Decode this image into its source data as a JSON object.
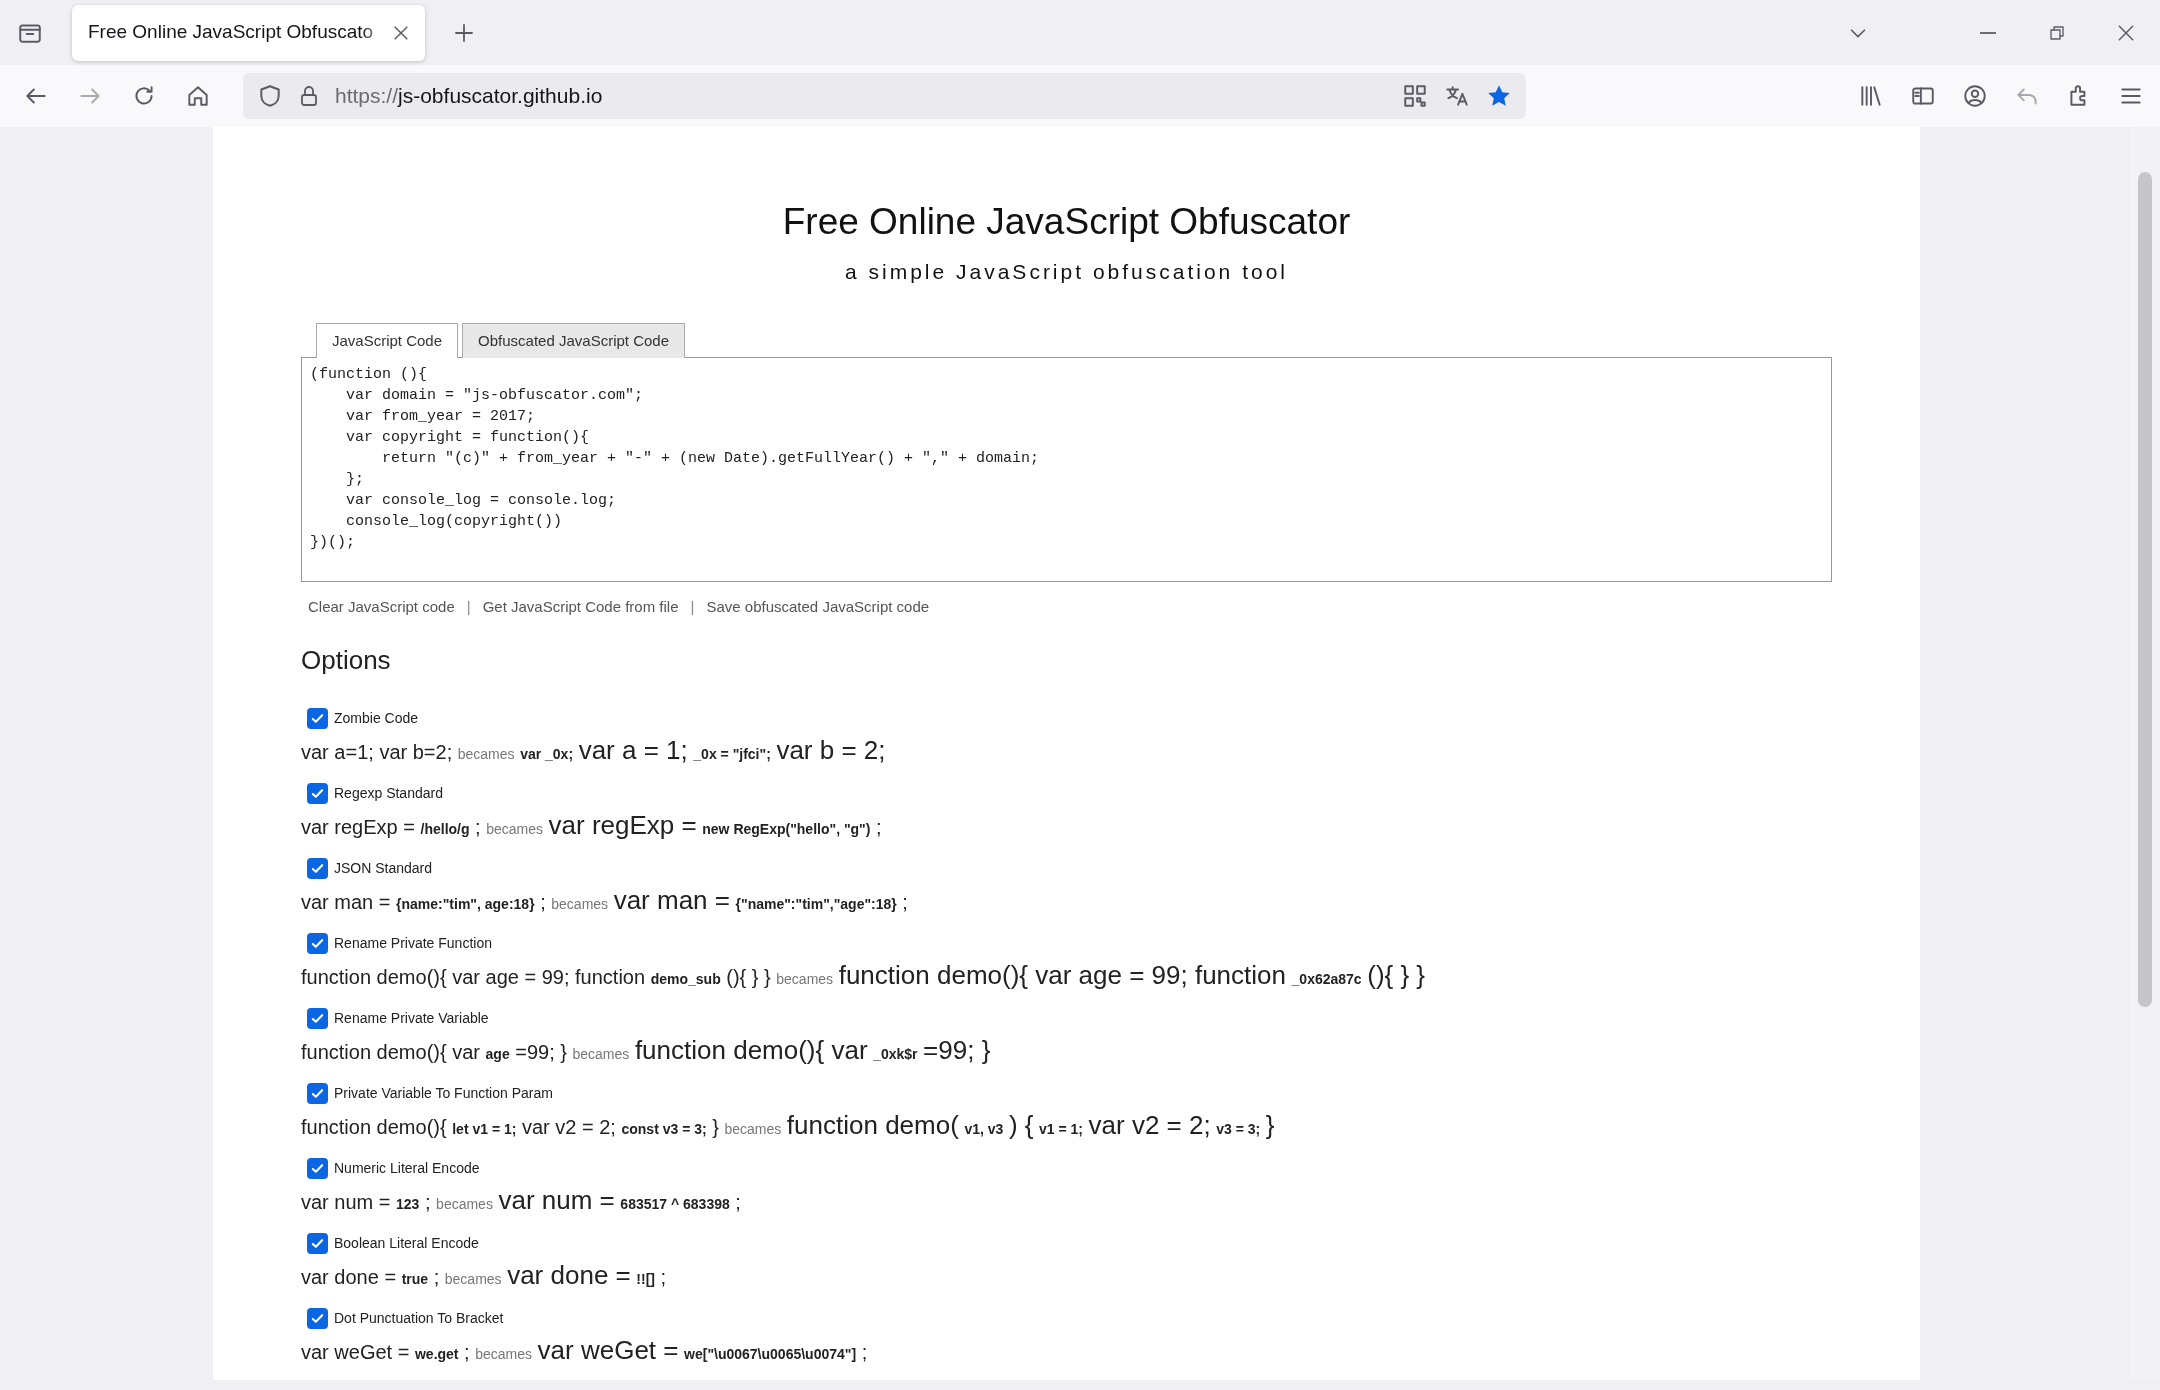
{
  "browser": {
    "tab_title": "Free Online JavaScript Obfuscato",
    "url_scheme": "https://",
    "url_host": "js-obfuscator.github.io",
    "bookmarked": true
  },
  "page": {
    "title": "Free Online JavaScript Obfuscator",
    "subtitle": "a simple JavaScript obfuscation tool",
    "tabs": [
      {
        "label": "JavaScript Code",
        "selected": true
      },
      {
        "label": "Obfuscated JavaScript Code",
        "selected": false
      }
    ],
    "code_lines": [
      "(function (){",
      "    var domain = \"js-obfuscator.com\";",
      "    var from_year = 2017;",
      "    var copyright = function(){",
      "        return \"(c)\" + from_year + \"-\" + (new Date).getFullYear() + \",\" + domain;",
      "    };",
      "    var console_log = console.log;",
      "    console_log(copyright())",
      "})();"
    ],
    "links": [
      {
        "kind": "link",
        "text": "Clear JavaScript code"
      },
      {
        "kind": "separator",
        "text": "|"
      },
      {
        "kind": "link",
        "text": "Get JavaScript Code from file"
      },
      {
        "kind": "separator",
        "text": "|"
      },
      {
        "kind": "link",
        "text": "Save obfuscated JavaScript code"
      }
    ],
    "options_heading": "Options",
    "options": [
      {
        "label": "Zombie Code",
        "checked": true,
        "example": [
          {
            "kind": "src",
            "text": "var a=1; var b=2;"
          },
          {
            "kind": "note",
            "text": "becames"
          },
          {
            "kind": "bold",
            "text": "var _0x;"
          },
          {
            "kind": "out",
            "text": "var a = 1;"
          },
          {
            "kind": "bold",
            "text": "_0x = \"jfci\";"
          },
          {
            "kind": "out",
            "text": "var b = 2;"
          }
        ]
      },
      {
        "label": "Regexp Standard",
        "checked": true,
        "example": [
          {
            "kind": "src",
            "text": "var regExp ="
          },
          {
            "kind": "bold",
            "text": "/hello/g"
          },
          {
            "kind": "src",
            "text": ";"
          },
          {
            "kind": "note",
            "text": "becames"
          },
          {
            "kind": "out",
            "text": "var regExp ="
          },
          {
            "kind": "bold",
            "text": "new RegExp(\"hello\", \"g\")"
          },
          {
            "kind": "src",
            "text": ";"
          }
        ]
      },
      {
        "label": "JSON Standard",
        "checked": true,
        "example": [
          {
            "kind": "src",
            "text": "var man ="
          },
          {
            "kind": "bold",
            "text": "{name:\"tim\", age:18}"
          },
          {
            "kind": "src",
            "text": ";"
          },
          {
            "kind": "note",
            "text": "becames"
          },
          {
            "kind": "out",
            "text": "var man ="
          },
          {
            "kind": "bold",
            "text": "{\"name\":\"tim\",\"age\":18}"
          },
          {
            "kind": "src",
            "text": ";"
          }
        ]
      },
      {
        "label": "Rename Private Function",
        "checked": true,
        "example": [
          {
            "kind": "src",
            "text": "function demo(){ var age = 99; function"
          },
          {
            "kind": "bold",
            "text": "demo_sub"
          },
          {
            "kind": "src",
            "text": "(){ } }"
          },
          {
            "kind": "note",
            "text": "becames"
          },
          {
            "kind": "out",
            "text": "function demo(){ var age = 99; function"
          },
          {
            "kind": "bold",
            "text": "_0x62a87c"
          },
          {
            "kind": "out",
            "text": "(){ } }"
          }
        ]
      },
      {
        "label": "Rename Private Variable",
        "checked": true,
        "example": [
          {
            "kind": "src",
            "text": "function demo(){ var"
          },
          {
            "kind": "bold",
            "text": "age"
          },
          {
            "kind": "src",
            "text": "=99; }"
          },
          {
            "kind": "note",
            "text": "becames"
          },
          {
            "kind": "out",
            "text": "function demo(){ var"
          },
          {
            "kind": "bold",
            "text": "_0xk$r"
          },
          {
            "kind": "out",
            "text": "=99; }"
          }
        ]
      },
      {
        "label": "Private Variable To Function Param",
        "checked": true,
        "example": [
          {
            "kind": "src",
            "text": "function demo(){"
          },
          {
            "kind": "bold",
            "text": "let v1 = 1;"
          },
          {
            "kind": "src",
            "text": "var v2 = 2;"
          },
          {
            "kind": "bold",
            "text": "const v3 = 3;"
          },
          {
            "kind": "src",
            "text": "}"
          },
          {
            "kind": "note",
            "text": "becames"
          },
          {
            "kind": "out",
            "text": "function demo("
          },
          {
            "kind": "bold",
            "text": "v1, v3"
          },
          {
            "kind": "out",
            "text": ") {"
          },
          {
            "kind": "bold",
            "text": "v1 = 1;"
          },
          {
            "kind": "out",
            "text": "var v2 = 2;"
          },
          {
            "kind": "bold",
            "text": "v3 = 3;"
          },
          {
            "kind": "out",
            "text": "}"
          }
        ]
      },
      {
        "label": "Numeric Literal Encode",
        "checked": true,
        "example": [
          {
            "kind": "src",
            "text": "var num ="
          },
          {
            "kind": "bold",
            "text": "123"
          },
          {
            "kind": "src",
            "text": ";"
          },
          {
            "kind": "note",
            "text": "becames"
          },
          {
            "kind": "out",
            "text": "var num ="
          },
          {
            "kind": "bold",
            "text": "683517 ^ 683398"
          },
          {
            "kind": "src",
            "text": ";"
          }
        ]
      },
      {
        "label": "Boolean Literal Encode",
        "checked": true,
        "example": [
          {
            "kind": "src",
            "text": "var done ="
          },
          {
            "kind": "bold",
            "text": "true"
          },
          {
            "kind": "src",
            "text": ";"
          },
          {
            "kind": "note",
            "text": "becames"
          },
          {
            "kind": "out",
            "text": "var done ="
          },
          {
            "kind": "bold",
            "text": "!![]"
          },
          {
            "kind": "src",
            "text": ";"
          }
        ]
      },
      {
        "label": "Dot Punctuation To Bracket",
        "checked": true,
        "example": [
          {
            "kind": "src",
            "text": "var weGet ="
          },
          {
            "kind": "bold",
            "text": "we.get"
          },
          {
            "kind": "src",
            "text": ";"
          },
          {
            "kind": "note",
            "text": "becames"
          },
          {
            "kind": "out",
            "text": "var weGet ="
          },
          {
            "kind": "bold",
            "text": "we[\"\\u0067\\u0065\\u0074\"]"
          },
          {
            "kind": "src",
            "text": ";"
          }
        ]
      }
    ]
  }
}
